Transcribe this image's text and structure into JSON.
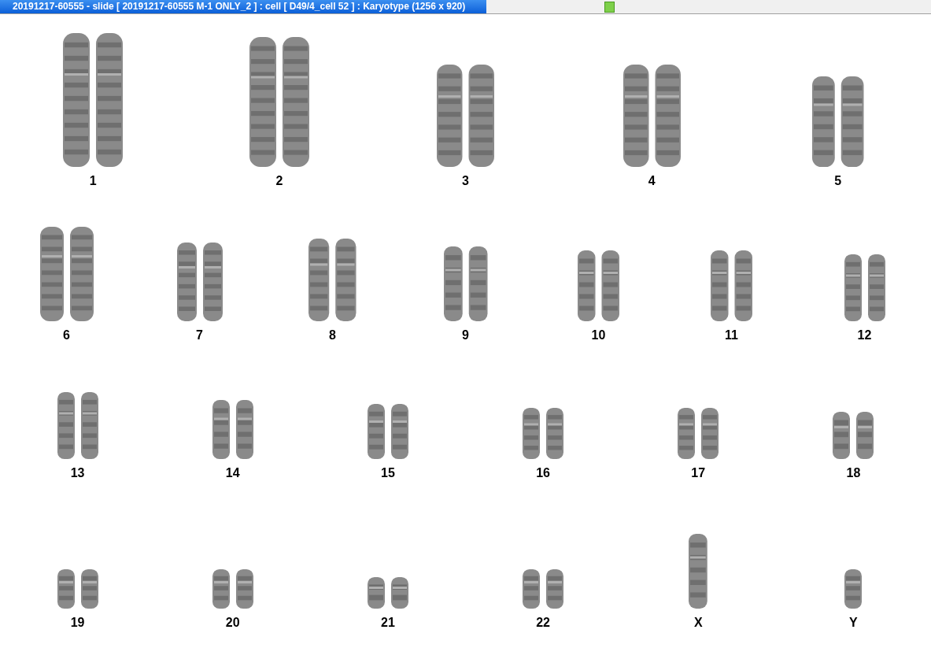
{
  "window": {
    "title": "20191217-60555 - slide [ 20191217-60555 M-1 ONLY_2 ] : cell [ D49/4_cell 52 ] : Karyotype  (1256 x 920)"
  },
  "karyotype_rows": [
    {
      "items": [
        {
          "label": "1",
          "kind": "pair"
        },
        {
          "label": "2",
          "kind": "pair"
        },
        {
          "label": "3",
          "kind": "pair"
        },
        {
          "label": "4",
          "kind": "pair"
        },
        {
          "label": "5",
          "kind": "pair"
        }
      ]
    },
    {
      "items": [
        {
          "label": "6",
          "kind": "pair"
        },
        {
          "label": "7",
          "kind": "pair"
        },
        {
          "label": "8",
          "kind": "pair"
        },
        {
          "label": "9",
          "kind": "pair"
        },
        {
          "label": "10",
          "kind": "pair"
        },
        {
          "label": "11",
          "kind": "pair"
        },
        {
          "label": "12",
          "kind": "pair"
        }
      ]
    },
    {
      "items": [
        {
          "label": "13",
          "kind": "pair"
        },
        {
          "label": "14",
          "kind": "pair"
        },
        {
          "label": "15",
          "kind": "pair"
        },
        {
          "label": "16",
          "kind": "pair"
        },
        {
          "label": "17",
          "kind": "pair"
        },
        {
          "label": "18",
          "kind": "pair"
        }
      ]
    },
    {
      "items": [
        {
          "label": "19",
          "kind": "pair"
        },
        {
          "label": "20",
          "kind": "pair"
        },
        {
          "label": "21",
          "kind": "pair"
        },
        {
          "label": "22",
          "kind": "pair"
        },
        {
          "label": "X",
          "kind": "single"
        },
        {
          "label": "Y",
          "kind": "single"
        }
      ]
    }
  ]
}
